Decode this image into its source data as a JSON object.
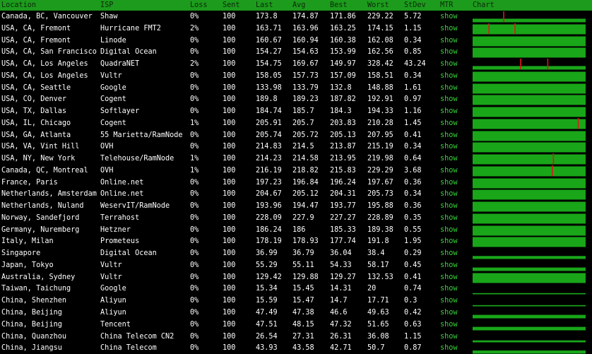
{
  "header": {
    "location": "Location",
    "isp": "ISP",
    "loss": "Loss",
    "sent": "Sent",
    "last": "Last",
    "avg": "Avg",
    "best": "Best",
    "worst": "Worst",
    "stdev": "StDev",
    "mtr": "MTR",
    "chart": "Chart"
  },
  "colors": {
    "header_bg": "#1d9b1d",
    "bar_green": "#19a619",
    "spike_red": "#e0161b",
    "link_green": "#39d33a"
  },
  "rows": [
    {
      "location": "Canada, BC, Vancouver",
      "isp": "Shaw",
      "loss": "0%",
      "sent": "100",
      "last": "173.8",
      "avg": "174.87",
      "best": "171.86",
      "worst": "229.22",
      "stdev": "5.72",
      "mtr": "show",
      "fill": 0.36,
      "spikes": [
        0.27
      ]
    },
    {
      "location": "USA, CA, Fremont",
      "isp": "Hurricane FMT2",
      "loss": "2%",
      "sent": "100",
      "last": "163.71",
      "avg": "163.96",
      "best": "163.25",
      "worst": "174.15",
      "stdev": "1.15",
      "mtr": "show",
      "fill": 1.0,
      "spikes": [
        0.14,
        0.37
      ]
    },
    {
      "location": "USA, CA, Fremont",
      "isp": "Linode",
      "loss": "0%",
      "sent": "100",
      "last": "160.67",
      "avg": "160.94",
      "best": "160.38",
      "worst": "162.08",
      "stdev": "0.34",
      "mtr": "show",
      "fill": 1.0,
      "spikes": []
    },
    {
      "location": "USA, CA, San Francisco",
      "isp": "Digital Ocean",
      "loss": "0%",
      "sent": "100",
      "last": "154.27",
      "avg": "154.63",
      "best": "153.99",
      "worst": "162.56",
      "stdev": "0.85",
      "mtr": "show",
      "fill": 1.0,
      "spikes": []
    },
    {
      "location": "USA, CA, Los Angeles",
      "isp": "QuadraNET",
      "loss": "2%",
      "sent": "100",
      "last": "154.75",
      "avg": "169.67",
      "best": "149.97",
      "worst": "328.42",
      "stdev": "43.24",
      "mtr": "show",
      "fill": 0.36,
      "spikes": [
        0.42,
        0.66
      ]
    },
    {
      "location": "USA, CA, Los Angeles",
      "isp": "Vultr",
      "loss": "0%",
      "sent": "100",
      "last": "158.05",
      "avg": "157.73",
      "best": "157.09",
      "worst": "158.51",
      "stdev": "0.34",
      "mtr": "show",
      "fill": 1.0,
      "spikes": []
    },
    {
      "location": "USA, CA, Seattle",
      "isp": "Google",
      "loss": "0%",
      "sent": "100",
      "last": "133.98",
      "avg": "133.79",
      "best": "132.8",
      "worst": "148.88",
      "stdev": "1.61",
      "mtr": "show",
      "fill": 1.0,
      "spikes": []
    },
    {
      "location": "USA, CO, Denver",
      "isp": "Cogent",
      "loss": "0%",
      "sent": "100",
      "last": "189.8",
      "avg": "189.23",
      "best": "187.82",
      "worst": "192.91",
      "stdev": "0.97",
      "mtr": "show",
      "fill": 1.0,
      "spikes": []
    },
    {
      "location": "USA, TX, Dallas",
      "isp": "Softlayer",
      "loss": "0%",
      "sent": "100",
      "last": "184.74",
      "avg": "185.7",
      "best": "184.3",
      "worst": "194.33",
      "stdev": "1.16",
      "mtr": "show",
      "fill": 1.0,
      "spikes": []
    },
    {
      "location": "USA, IL, Chicago",
      "isp": "Cogent",
      "loss": "1%",
      "sent": "100",
      "last": "205.91",
      "avg": "205.7",
      "best": "203.83",
      "worst": "210.28",
      "stdev": "1.45",
      "mtr": "show",
      "fill": 1.0,
      "spikes": [
        0.93
      ]
    },
    {
      "location": "USA, GA, Atlanta",
      "isp": "55 Marietta/RamNode",
      "loss": "0%",
      "sent": "100",
      "last": "205.74",
      "avg": "205.72",
      "best": "205.13",
      "worst": "207.95",
      "stdev": "0.41",
      "mtr": "show",
      "fill": 1.0,
      "spikes": []
    },
    {
      "location": "USA, VA, Vint Hill",
      "isp": "OVH",
      "loss": "0%",
      "sent": "100",
      "last": "214.83",
      "avg": "214.5",
      "best": "213.87",
      "worst": "215.19",
      "stdev": "0.34",
      "mtr": "show",
      "fill": 1.0,
      "spikes": []
    },
    {
      "location": "USA, NY, New York",
      "isp": "Telehouse/RamNode",
      "loss": "1%",
      "sent": "100",
      "last": "214.23",
      "avg": "214.58",
      "best": "213.95",
      "worst": "219.98",
      "stdev": "0.64",
      "mtr": "show",
      "fill": 1.0,
      "spikes": [
        0.71
      ]
    },
    {
      "location": "Canada, QC, Montreal",
      "isp": "OVH",
      "loss": "1%",
      "sent": "100",
      "last": "216.19",
      "avg": "218.82",
      "best": "215.83",
      "worst": "229.29",
      "stdev": "3.68",
      "mtr": "show",
      "fill": 1.0,
      "spikes": [
        0.7
      ]
    },
    {
      "location": "France, Paris",
      "isp": "Online.net",
      "loss": "0%",
      "sent": "100",
      "last": "197.23",
      "avg": "196.84",
      "best": "196.24",
      "worst": "197.67",
      "stdev": "0.36",
      "mtr": "show",
      "fill": 1.0,
      "spikes": []
    },
    {
      "location": "Netherlands, Amsterdam",
      "isp": "Online.net",
      "loss": "0%",
      "sent": "100",
      "last": "204.67",
      "avg": "205.12",
      "best": "204.31",
      "worst": "205.73",
      "stdev": "0.34",
      "mtr": "show",
      "fill": 1.0,
      "spikes": []
    },
    {
      "location": "Netherlands, Nuland",
      "isp": "WeservIT/RamNode",
      "loss": "0%",
      "sent": "100",
      "last": "193.96",
      "avg": "194.47",
      "best": "193.77",
      "worst": "195.88",
      "stdev": "0.36",
      "mtr": "show",
      "fill": 1.0,
      "spikes": []
    },
    {
      "location": "Norway, Sandefjord",
      "isp": "Terrahost",
      "loss": "0%",
      "sent": "100",
      "last": "228.09",
      "avg": "227.9",
      "best": "227.27",
      "worst": "228.89",
      "stdev": "0.35",
      "mtr": "show",
      "fill": 1.0,
      "spikes": []
    },
    {
      "location": "Germany, Nuremberg",
      "isp": "Hetzner",
      "loss": "0%",
      "sent": "100",
      "last": "186.24",
      "avg": "186",
      "best": "185.33",
      "worst": "189.38",
      "stdev": "0.55",
      "mtr": "show",
      "fill": 1.0,
      "spikes": []
    },
    {
      "location": "Italy, Milan",
      "isp": "Prometeus",
      "loss": "0%",
      "sent": "100",
      "last": "178.19",
      "avg": "178.93",
      "best": "177.74",
      "worst": "191.8",
      "stdev": "1.95",
      "mtr": "show",
      "fill": 1.0,
      "spikes": []
    },
    {
      "location": "Singapore",
      "isp": "Digital Ocean",
      "loss": "0%",
      "sent": "100",
      "last": "36.99",
      "avg": "36.79",
      "best": "36.04",
      "worst": "38.4",
      "stdev": "0.29",
      "mtr": "show",
      "fill": 0.3,
      "spikes": []
    },
    {
      "location": "Japan, Tokyo",
      "isp": "Vultr",
      "loss": "0%",
      "sent": "100",
      "last": "55.29",
      "avg": "55.11",
      "best": "54.33",
      "worst": "58.17",
      "stdev": "0.45",
      "mtr": "show",
      "fill": 0.35,
      "spikes": []
    },
    {
      "location": "Australia, Sydney",
      "isp": "Vultr",
      "loss": "0%",
      "sent": "100",
      "last": "129.42",
      "avg": "129.88",
      "best": "129.27",
      "worst": "132.53",
      "stdev": "0.41",
      "mtr": "show",
      "fill": 1.0,
      "spikes": []
    },
    {
      "location": "Taiwan, Taichung",
      "isp": "Google",
      "loss": "0%",
      "sent": "100",
      "last": "15.34",
      "avg": "15.45",
      "best": "14.31",
      "worst": "20",
      "stdev": "0.74",
      "mtr": "show",
      "fill": 0.12,
      "spikes": []
    },
    {
      "location": "China, Shenzhen",
      "isp": "Aliyun",
      "loss": "0%",
      "sent": "100",
      "last": "15.59",
      "avg": "15.47",
      "best": "14.7",
      "worst": "17.71",
      "stdev": "0.3",
      "mtr": "show",
      "fill": 0.12,
      "spikes": []
    },
    {
      "location": "China, Beijing",
      "isp": "Aliyun",
      "loss": "0%",
      "sent": "100",
      "last": "47.49",
      "avg": "47.38",
      "best": "46.6",
      "worst": "49.63",
      "stdev": "0.42",
      "mtr": "show",
      "fill": 0.35,
      "spikes": []
    },
    {
      "location": "China, Beijing",
      "isp": "Tencent",
      "loss": "0%",
      "sent": "100",
      "last": "47.51",
      "avg": "48.15",
      "best": "47.32",
      "worst": "51.65",
      "stdev": "0.63",
      "mtr": "show",
      "fill": 0.35,
      "spikes": []
    },
    {
      "location": "China, Quanzhou",
      "isp": "China Telecom CN2",
      "loss": "0%",
      "sent": "100",
      "last": "26.54",
      "avg": "27.31",
      "best": "26.31",
      "worst": "36.08",
      "stdev": "1.15",
      "mtr": "show",
      "fill": 0.2,
      "spikes": []
    },
    {
      "location": "China, Jiangsu",
      "isp": "China Telecom",
      "loss": "0%",
      "sent": "100",
      "last": "43.93",
      "avg": "43.58",
      "best": "42.71",
      "worst": "50.7",
      "stdev": "0.87",
      "mtr": "show",
      "fill": 0.32,
      "spikes": []
    }
  ]
}
